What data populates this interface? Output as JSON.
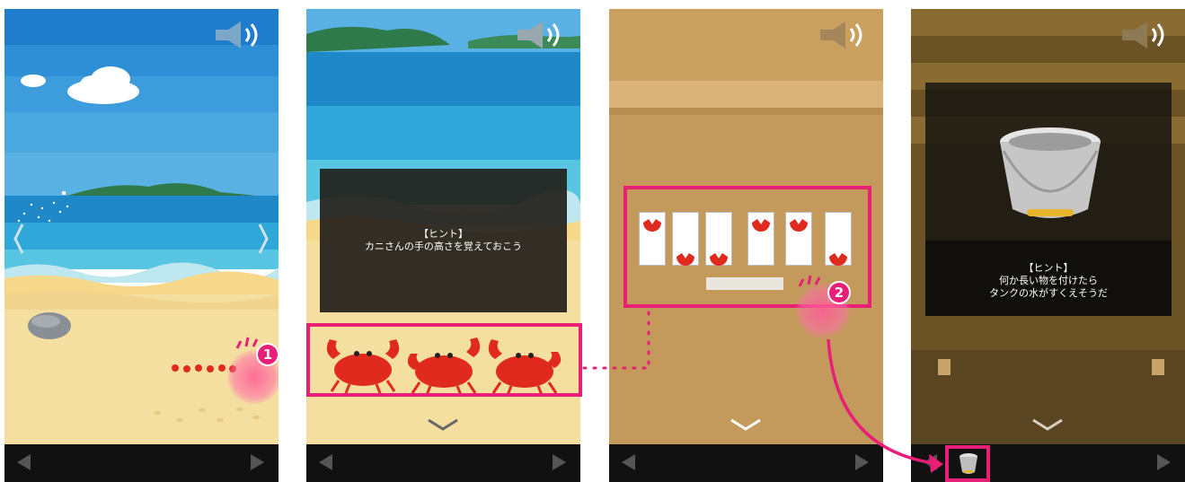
{
  "screens": [
    {
      "id": "beach",
      "sound_icon": "speaker-icon"
    },
    {
      "id": "beach-hint",
      "hint_title": "【ヒント】",
      "hint_text": "カニさんの手の高さを覚えておこう"
    },
    {
      "id": "card-puzzle"
    },
    {
      "id": "bucket-hint",
      "hint_title": "【ヒント】",
      "hint_line1": "何か長い物を付けたら",
      "hint_line2": "タンクの水がすくえそうだ"
    }
  ],
  "steps": [
    {
      "number": "1"
    },
    {
      "number": "2"
    }
  ],
  "card_marks": [
    "top",
    "bottom",
    "bottom",
    "top",
    "top",
    "bottom"
  ],
  "colors": {
    "highlight": "#e81e77",
    "crab": "#e02a1e",
    "sea": "#2a97d2",
    "sand": "#f4dfa0",
    "wood": "#c9a060"
  }
}
